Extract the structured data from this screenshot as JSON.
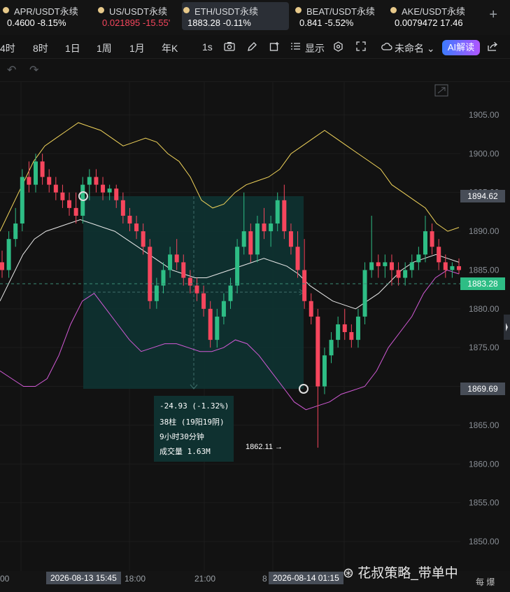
{
  "tickers": [
    {
      "name": "APR/USDT永续",
      "price": "0.4600",
      "change": "-8.15%",
      "price_color": "#ffffff",
      "change_color": "#ffffff"
    },
    {
      "name": "US/USDT永续",
      "price": "0.021895",
      "change": "-15.55'",
      "price_color": "#f6465d",
      "change_color": "#f6465d"
    },
    {
      "name": "ETH/USDT永续",
      "price": "1883.28",
      "change": "-0.11%",
      "price_color": "#ffffff",
      "change_color": "#ffffff"
    },
    {
      "name": "BEAT/USDT永续",
      "price": "0.841",
      "change": "-5.52%",
      "price_color": "#ffffff",
      "change_color": "#ffffff"
    },
    {
      "name": "AKE/USDT永续",
      "price": "0.0079472",
      "change": "17.46",
      "price_color": "#ffffff",
      "change_color": "#ffffff"
    }
  ],
  "toolbar": {
    "intervals": [
      "4时",
      "8时",
      "1日",
      "1周",
      "1月",
      "年K"
    ],
    "interval_1s": "1s",
    "indicator_label": "显示",
    "unnamed_label": "未命名",
    "ai_label": "AI解读"
  },
  "price_axis": {
    "ticks": [
      "1905.00",
      "1900.00",
      "1895.00",
      "1890.00",
      "1885.00",
      "1880.00",
      "1875.00",
      "1870.00",
      "1865.00",
      "1860.00",
      "1855.00",
      "1850.00"
    ],
    "labels": {
      "top_price": "1894.62",
      "current_price": "1883.28",
      "bottom_price": "1869.69"
    }
  },
  "measure": {
    "change": "-24.93 (-1.32%)",
    "bars": "38柱 (19阳19阴)",
    "duration": "9小时30分钟",
    "volume": "成交量 1.63M"
  },
  "low_label": "1862.11 →",
  "time_axis": {
    "labels": [
      "00",
      "18:00",
      "21:00",
      "8"
    ],
    "highlight_start": "2026-08-13 15:45",
    "highlight_end": "2026-08-14 01:15"
  },
  "watermark": "⊛ 花叔策略_带单中",
  "watermark_sub": "每 爆",
  "colors": {
    "up": "#2ebd85",
    "down": "#f6465d",
    "boll_upper": "#f0d35a",
    "boll_mid": "#e9e9e9",
    "boll_lower": "#d25ad6",
    "current": "#2ebd85"
  },
  "chart_data": {
    "type": "candlestick",
    "price_range": [
      1847,
      1909
    ],
    "candles": [
      [
        1886,
        1887.5,
        1884,
        1885
      ],
      [
        1885,
        1890,
        1884,
        1889
      ],
      [
        1889,
        1893,
        1888,
        1891
      ],
      [
        1891,
        1898,
        1890,
        1897
      ],
      [
        1897,
        1899,
        1895,
        1896
      ],
      [
        1896,
        1900,
        1895,
        1899
      ],
      [
        1899,
        1900,
        1896,
        1897
      ],
      [
        1897,
        1898,
        1895,
        1896
      ],
      [
        1896,
        1897,
        1894,
        1895
      ],
      [
        1895,
        1896,
        1893,
        1894
      ],
      [
        1894,
        1895,
        1892,
        1893
      ],
      [
        1893,
        1895,
        1891,
        1892
      ],
      [
        1892,
        1897,
        1891,
        1896
      ],
      [
        1896,
        1898,
        1894,
        1897
      ],
      [
        1897,
        1898,
        1895,
        1896
      ],
      [
        1896,
        1897,
        1894,
        1895
      ],
      [
        1895,
        1896,
        1894,
        1895.5
      ],
      [
        1895.5,
        1896,
        1893,
        1894
      ],
      [
        1894,
        1895,
        1891,
        1892
      ],
      [
        1892,
        1893,
        1890,
        1891
      ],
      [
        1891,
        1892,
        1889,
        1890
      ],
      [
        1890,
        1891,
        1887,
        1888
      ],
      [
        1888,
        1889,
        1880,
        1881
      ],
      [
        1881,
        1884,
        1880,
        1883
      ],
      [
        1883,
        1886,
        1882,
        1885
      ],
      [
        1885,
        1888,
        1884,
        1887
      ],
      [
        1887,
        1889,
        1885,
        1886
      ],
      [
        1886,
        1887,
        1883,
        1884
      ],
      [
        1884,
        1885,
        1882,
        1883
      ],
      [
        1883,
        1884,
        1881,
        1882
      ],
      [
        1882,
        1883,
        1879,
        1880
      ],
      [
        1880,
        1881,
        1875,
        1876
      ],
      [
        1876,
        1880,
        1875,
        1879
      ],
      [
        1879,
        1882,
        1878,
        1881
      ],
      [
        1881,
        1884,
        1880,
        1883
      ],
      [
        1883,
        1889,
        1882,
        1888
      ],
      [
        1888,
        1895,
        1887,
        1890
      ],
      [
        1890,
        1891,
        1886,
        1887
      ],
      [
        1887,
        1892,
        1886,
        1891
      ],
      [
        1891,
        1893,
        1889,
        1890
      ],
      [
        1890,
        1892,
        1888,
        1891
      ],
      [
        1891,
        1895,
        1890,
        1894
      ],
      [
        1894,
        1896,
        1889,
        1890
      ],
      [
        1890,
        1891,
        1887,
        1888
      ],
      [
        1888,
        1890,
        1884,
        1885
      ],
      [
        1885,
        1889,
        1880,
        1881
      ],
      [
        1881,
        1882,
        1878,
        1879
      ],
      [
        1879,
        1880,
        1862.1,
        1870
      ],
      [
        1870,
        1875,
        1869,
        1874
      ],
      [
        1874,
        1877,
        1873,
        1876
      ],
      [
        1876,
        1879,
        1875,
        1878
      ],
      [
        1878,
        1880,
        1876,
        1877
      ],
      [
        1877,
        1878,
        1875,
        1876
      ],
      [
        1876,
        1880,
        1875,
        1879
      ],
      [
        1879,
        1886,
        1878,
        1885
      ],
      [
        1885,
        1892,
        1884,
        1886
      ],
      [
        1886,
        1887,
        1884,
        1885.5
      ],
      [
        1885.5,
        1887,
        1884,
        1886
      ],
      [
        1886,
        1887,
        1883,
        1885
      ],
      [
        1885,
        1886,
        1883,
        1884
      ],
      [
        1884,
        1886,
        1883,
        1885
      ],
      [
        1885,
        1887,
        1884,
        1886
      ],
      [
        1886,
        1888,
        1885,
        1887
      ],
      [
        1887,
        1892,
        1886,
        1890
      ],
      [
        1890,
        1891,
        1887,
        1888
      ],
      [
        1888,
        1889,
        1885,
        1886
      ],
      [
        1886,
        1887,
        1884,
        1885
      ],
      [
        1885,
        1886,
        1884,
        1885.5
      ],
      [
        1885.5,
        1886.5,
        1884.5,
        1885
      ]
    ],
    "boll_upper": [
      1890,
      1893,
      1896,
      1899,
      1901,
      1902,
      1903,
      1904,
      1903.5,
      1903,
      1902,
      1901,
      1901.5,
      1902,
      1901.5,
      1900,
      1899,
      1897,
      1894,
      1893,
      1893.5,
      1895,
      1896,
      1896.5,
      1897,
      1898,
      1900,
      1901,
      1902,
      1903,
      1902,
      1901,
      1900,
      1899,
      1898,
      1896,
      1895,
      1894,
      1893,
      1891,
      1890,
      1890.5
    ],
    "boll_mid": [
      1881,
      1884,
      1887,
      1889,
      1890,
      1890.5,
      1891,
      1891.5,
      1891,
      1890.5,
      1890,
      1889,
      1888,
      1887,
      1886,
      1885,
      1884.5,
      1884,
      1884,
      1884.5,
      1885,
      1885.5,
      1886,
      1886.5,
      1886,
      1885.5,
      1884.5,
      1883,
      1882,
      1881,
      1880.5,
      1880,
      1881,
      1882,
      1883.5,
      1885,
      1886,
      1886.5,
      1887,
      1886.5,
      1886
    ],
    "boll_lower": [
      1872,
      1871,
      1870,
      1870,
      1871,
      1874,
      1878,
      1881,
      1882,
      1880,
      1878,
      1876,
      1874.5,
      1875,
      1875.5,
      1875.5,
      1875,
      1874.5,
      1874.5,
      1875,
      1876,
      1875.5,
      1874,
      1872,
      1870,
      1868,
      1867,
      1867.5,
      1868,
      1869,
      1869.5,
      1870,
      1872,
      1875,
      1877,
      1879,
      1882,
      1884,
      1885,
      1884.5
    ]
  }
}
